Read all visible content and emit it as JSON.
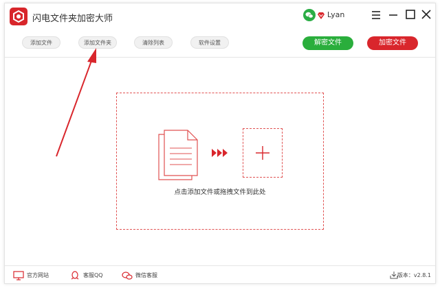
{
  "app": {
    "title": "闪电文件夹加密大师",
    "user": "Lyan"
  },
  "toolbar": {
    "add_file": "添加文件",
    "add_folder": "添加文件夹",
    "clear_list": "清除列表",
    "settings": "软件设置",
    "decrypt": "解密文件",
    "encrypt": "加密文件"
  },
  "dropzone": {
    "hint": "点击添加文件或拖拽文件到此处"
  },
  "status": {
    "website": "官方网站",
    "qq": "客服QQ",
    "wechat": "微信客服",
    "version": "版本：v2.8.1"
  },
  "colors": {
    "brand": "#d8262b",
    "decrypt": "#2aae3c",
    "encrypt": "#d9262c",
    "dashed": "#e05050"
  }
}
